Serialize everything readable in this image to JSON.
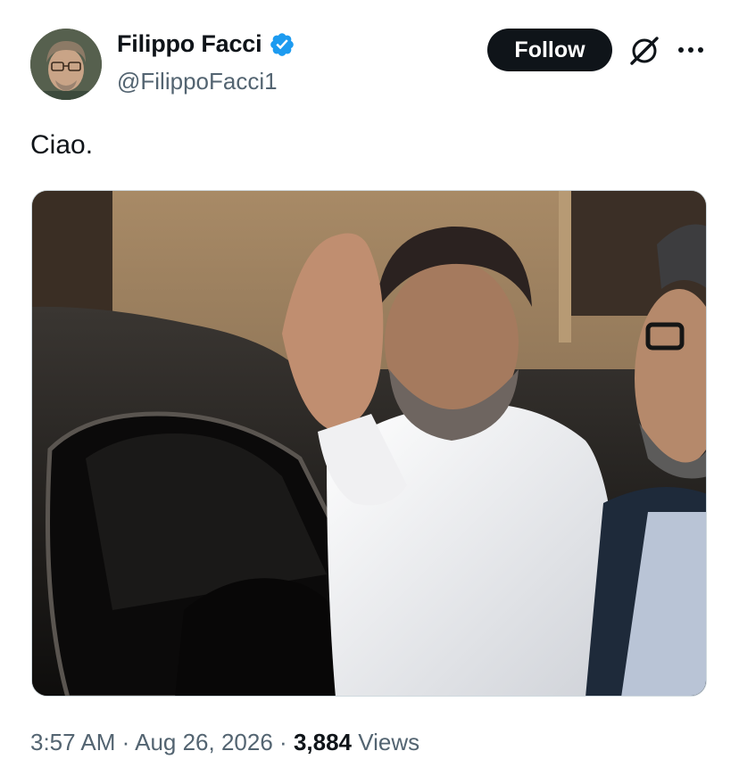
{
  "author": {
    "display_name": "Filippo Facci",
    "handle": "@FilippoFacci1",
    "verified": true
  },
  "actions": {
    "follow_label": "Follow"
  },
  "icons": {
    "verified": "verified-badge-icon",
    "grok": "grok-icon",
    "more": "more-options-icon"
  },
  "tweet": {
    "text": "Ciao.",
    "time": "3:57 AM",
    "separator": "·",
    "date": "Aug 26, 2026",
    "views_count": "3,884",
    "views_label": "Views"
  },
  "colors": {
    "verified_blue": "#1d9bf0",
    "text_primary": "#0f1419",
    "text_secondary": "#536471",
    "button_bg": "#0f1419"
  }
}
